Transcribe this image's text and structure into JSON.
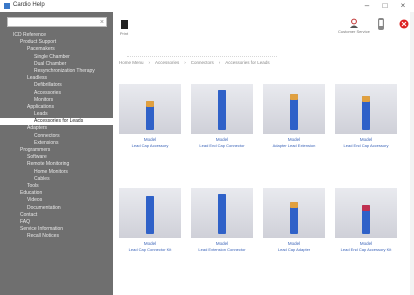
{
  "window": {
    "title": "Cardio Help"
  },
  "sidebar": {
    "search_placeholder": "",
    "tree": [
      {
        "label": "ICD Reference",
        "depth": 1,
        "selected": false
      },
      {
        "label": "Product Support",
        "depth": 2,
        "selected": false
      },
      {
        "label": "Pacemakers",
        "depth": 3,
        "selected": false
      },
      {
        "label": "Single Chamber",
        "depth": 4,
        "selected": false
      },
      {
        "label": "Dual Chamber",
        "depth": 4,
        "selected": false
      },
      {
        "label": "Resynchronization Therapy",
        "depth": 4,
        "selected": false
      },
      {
        "label": "Leadless",
        "depth": 3,
        "selected": false
      },
      {
        "label": "Defibrillators",
        "depth": 4,
        "selected": false
      },
      {
        "label": "Accessories",
        "depth": 4,
        "selected": false
      },
      {
        "label": "Monitors",
        "depth": 4,
        "selected": false
      },
      {
        "label": "Applications",
        "depth": 3,
        "selected": false
      },
      {
        "label": "Leads",
        "depth": 4,
        "selected": false
      },
      {
        "label": "Accessories for Leads",
        "depth": 4,
        "selected": true
      },
      {
        "label": "Adapters",
        "depth": 3,
        "selected": false
      },
      {
        "label": "Connectors",
        "depth": 4,
        "selected": false
      },
      {
        "label": "Extensions",
        "depth": 4,
        "selected": false
      },
      {
        "label": "Programmers",
        "depth": 2,
        "selected": false
      },
      {
        "label": "Software",
        "depth": 3,
        "selected": false
      },
      {
        "label": "Remote Monitoring",
        "depth": 3,
        "selected": false
      },
      {
        "label": "Home Monitors",
        "depth": 4,
        "selected": false
      },
      {
        "label": "Cables",
        "depth": 4,
        "selected": false
      },
      {
        "label": "Tools",
        "depth": 3,
        "selected": false
      },
      {
        "label": "Education",
        "depth": 2,
        "selected": false
      },
      {
        "label": "Videos",
        "depth": 3,
        "selected": false
      },
      {
        "label": "Documentation",
        "depth": 3,
        "selected": false
      },
      {
        "label": "Contact",
        "depth": 2,
        "selected": false
      },
      {
        "label": "FAQ",
        "depth": 2,
        "selected": false
      },
      {
        "label": "Service Information",
        "depth": 2,
        "selected": false
      },
      {
        "label": "Recall Notices",
        "depth": 3,
        "selected": false
      }
    ]
  },
  "toolbar": {
    "left_label": "Print",
    "buttons": [
      {
        "icon": "user-icon",
        "label": "Customer Service"
      },
      {
        "icon": "info-icon",
        "label": "Info"
      },
      {
        "icon": "close-icon",
        "label": ""
      }
    ]
  },
  "breadcrumb": [
    "Home Menu",
    "Accessories",
    "Connectors",
    "Accessories for Leads"
  ],
  "products": [
    {
      "cap1": "Model",
      "cap2": "Lead Cap Accessory",
      "color": "#2f61c8",
      "cap_color": "#e0a040",
      "height": 0.7
    },
    {
      "cap1": "Model",
      "cap2": "Lead End Cap Connector",
      "color": "#2f61c8",
      "cap_color": "#2f61c8",
      "height": 0.95
    },
    {
      "cap1": "Model",
      "cap2": "Adapter Lead Extension",
      "color": "#2f61c8",
      "cap_color": "#e0a040",
      "height": 0.85
    },
    {
      "cap1": "Model",
      "cap2": "Lead End Cap Accessory",
      "color": "#2f61c8",
      "cap_color": "#e0a040",
      "height": 0.8
    },
    {
      "cap1": "Model",
      "cap2": "Lead Cap Connector Kit",
      "color": "#2f61c8",
      "cap_color": "#2f61c8",
      "height": 0.9
    },
    {
      "cap1": "Model",
      "cap2": "Lead Extension Connector",
      "color": "#2f61c8",
      "cap_color": "#2f61c8",
      "height": 0.95
    },
    {
      "cap1": "Model",
      "cap2": "Lead Cap Adapter",
      "color": "#2f61c8",
      "cap_color": "#e0a040",
      "height": 0.75
    },
    {
      "cap1": "Model",
      "cap2": "Lead End Cap Accessory Kit",
      "color": "#2f61c8",
      "cap_color": "#c03050",
      "height": 0.7
    }
  ]
}
